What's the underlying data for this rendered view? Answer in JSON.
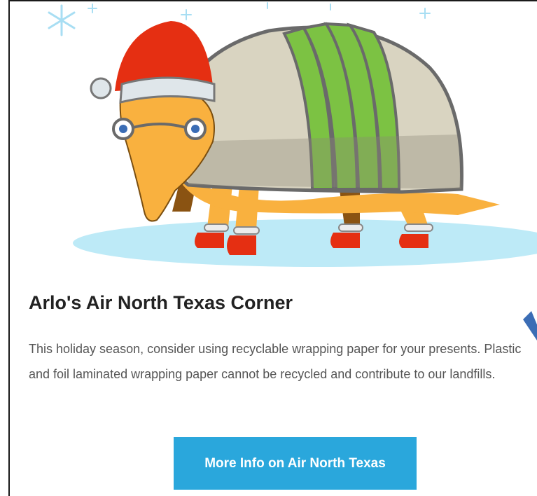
{
  "article": {
    "headline": "Arlo's Air North Texas Corner",
    "body": "This holiday season, consider using recyclable wrapping paper for your presents. Plastic and foil laminated wrapping paper cannot be recycled and contribute to our landfills.",
    "cta_label": "More Info on Air North Texas"
  },
  "colors": {
    "accent": "#2aa7dc",
    "armadillo_body": "#f9b13f",
    "armor": "#d9d4c1",
    "green_bands": "#7cc243",
    "santa_hat": "#e52f12",
    "ground": "#bdeaf7"
  },
  "icons": {
    "snowflake": "snowflake-icon",
    "arrow": "arrow-pointer-icon"
  }
}
